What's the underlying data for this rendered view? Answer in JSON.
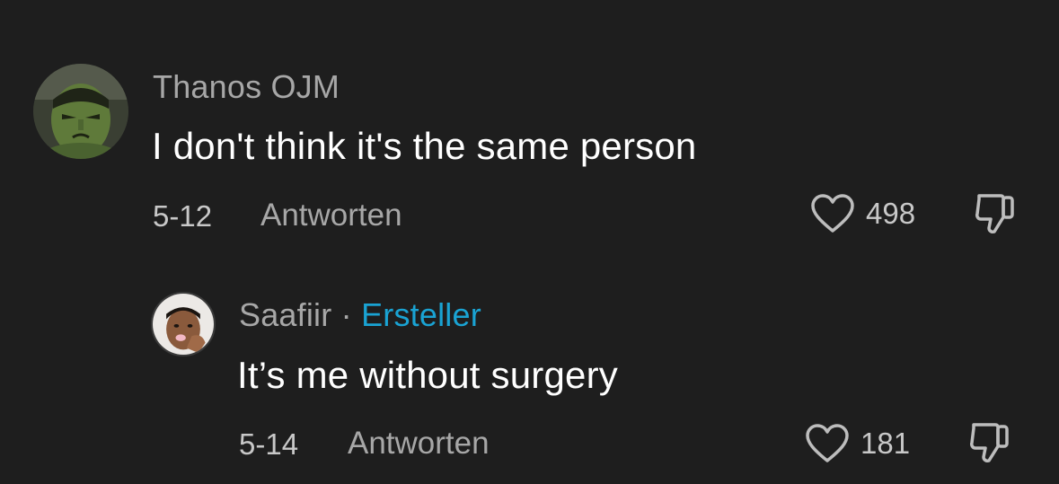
{
  "comments": [
    {
      "username": "Thanos OJM",
      "text": "I don't think it's the same person",
      "date": "5-12",
      "reply_label": "Antworten",
      "likes": "498",
      "avatar_icon": "hulk-avatar"
    },
    {
      "username": "Saafiir",
      "separator": "·",
      "badge": "Ersteller",
      "text": "It’s me without surgery",
      "date": "5-14",
      "reply_label": "Antworten",
      "likes": "181",
      "avatar_icon": "user-photo-avatar"
    }
  ],
  "colors": {
    "background": "#1e1e1e",
    "muted_text": "#a7a7a7",
    "creator_badge": "#1aa3d3"
  }
}
